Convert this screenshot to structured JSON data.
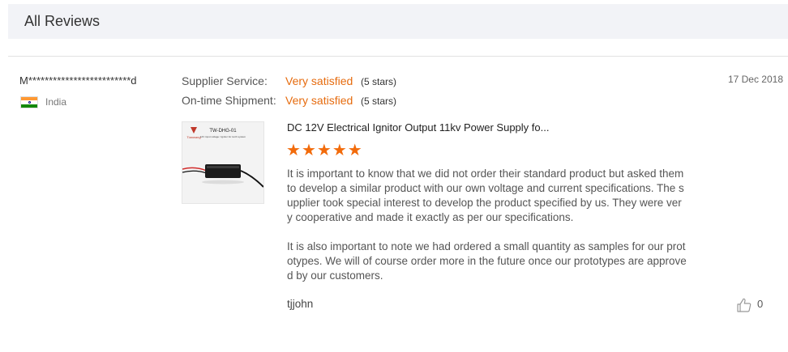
{
  "header": {
    "title": "All Reviews"
  },
  "review": {
    "reviewer": "M*************************d",
    "country": "India",
    "date": "17 Dec 2018",
    "ratings": [
      {
        "label": "Supplier Service:",
        "value": "Very satisfied",
        "stars_text": "(5 stars)"
      },
      {
        "label": "On-time Shipment:",
        "value": "Very satisfied",
        "stars_text": "(5 stars)"
      }
    ],
    "product": {
      "title": "DC 12V Electrical Ignitor Output 11kv Power Supply fo...",
      "rating": 5,
      "image_label": "TW-DHG-01",
      "image_caption": "12V input voltage / Ignitor for torch system",
      "image_brand": "Tianwang"
    },
    "paragraphs": [
      "It is important to know that we did not order their standard product but asked them to develop a similar product with our own voltage and current specifications. The supplier took special interest to develop the product specified by us. They were very cooperative and made it exactly as per our specifications.",
      "It is also important to note we had ordered a small quantity as samples for our prototypes. We will of course order more in the future once our prototypes are approved by our customers."
    ],
    "author": "tjjohn",
    "helpful_count": "0"
  },
  "colors": {
    "accent": "#e66b0e",
    "star": "#f26b0b",
    "header_bg": "#f2f3f7"
  }
}
